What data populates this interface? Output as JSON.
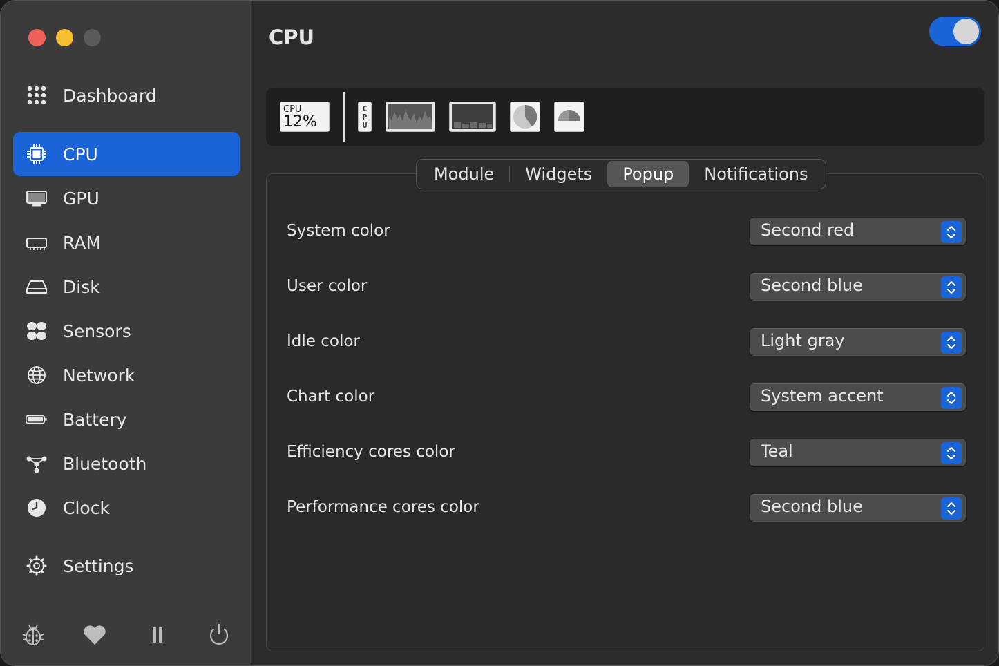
{
  "window": {
    "traffic_lights": [
      "close",
      "minimize",
      "zoom"
    ]
  },
  "sidebar": {
    "items": [
      {
        "label": "Dashboard",
        "icon": "grid-dots-icon",
        "active": false
      },
      {
        "label": "CPU",
        "icon": "cpu-chip-icon",
        "active": true
      },
      {
        "label": "GPU",
        "icon": "display-icon",
        "active": false
      },
      {
        "label": "RAM",
        "icon": "memory-icon",
        "active": false
      },
      {
        "label": "Disk",
        "icon": "disk-drive-icon",
        "active": false
      },
      {
        "label": "Sensors",
        "icon": "fan-icon",
        "active": false
      },
      {
        "label": "Network",
        "icon": "globe-icon",
        "active": false
      },
      {
        "label": "Battery",
        "icon": "battery-icon",
        "active": false
      },
      {
        "label": "Bluetooth",
        "icon": "bluetooth-nodes-icon",
        "active": false
      },
      {
        "label": "Clock",
        "icon": "clock-icon",
        "active": false
      },
      {
        "label": "Settings",
        "icon": "gear-icon",
        "active": false
      }
    ],
    "footer": [
      "bug-icon",
      "heart-icon",
      "pause-icon",
      "power-icon"
    ]
  },
  "main": {
    "title": "CPU",
    "enabled": true,
    "widgets": {
      "mini_label": "CPU",
      "mini_value": "12%",
      "label_glyphs": "CPU"
    },
    "tabs": [
      {
        "label": "Module",
        "active": false
      },
      {
        "label": "Widgets",
        "active": false
      },
      {
        "label": "Popup",
        "active": true
      },
      {
        "label": "Notifications",
        "active": false
      }
    ],
    "settings": [
      {
        "label": "System color",
        "value": "Second red"
      },
      {
        "label": "User color",
        "value": "Second blue"
      },
      {
        "label": "Idle color",
        "value": "Light gray"
      },
      {
        "label": "Chart color",
        "value": "System accent"
      },
      {
        "label": "Efficiency cores color",
        "value": "Teal"
      },
      {
        "label": "Performance cores color",
        "value": "Second blue"
      }
    ]
  },
  "colors": {
    "accent": "#1b64d8",
    "sidebar_bg": "#3b3b3b",
    "main_bg": "#2c2c2c",
    "close": "#ed5f57",
    "minimize": "#f5bd2f"
  }
}
